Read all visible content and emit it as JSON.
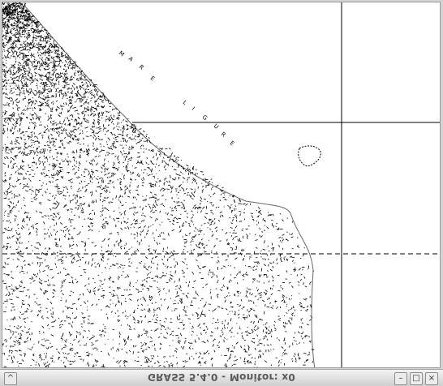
{
  "window": {
    "title": "GRASS 5.4.0 - Monitor: x0",
    "buttons": {
      "menu": "icon:chevron-up",
      "minimize": "icon:minimize",
      "maximize": "icon:maximize",
      "close": "icon:close"
    }
  },
  "map": {
    "sea_label": "MARE LIGURE",
    "colors": {
      "background": "#ffffff",
      "ink": "#000000"
    }
  }
}
